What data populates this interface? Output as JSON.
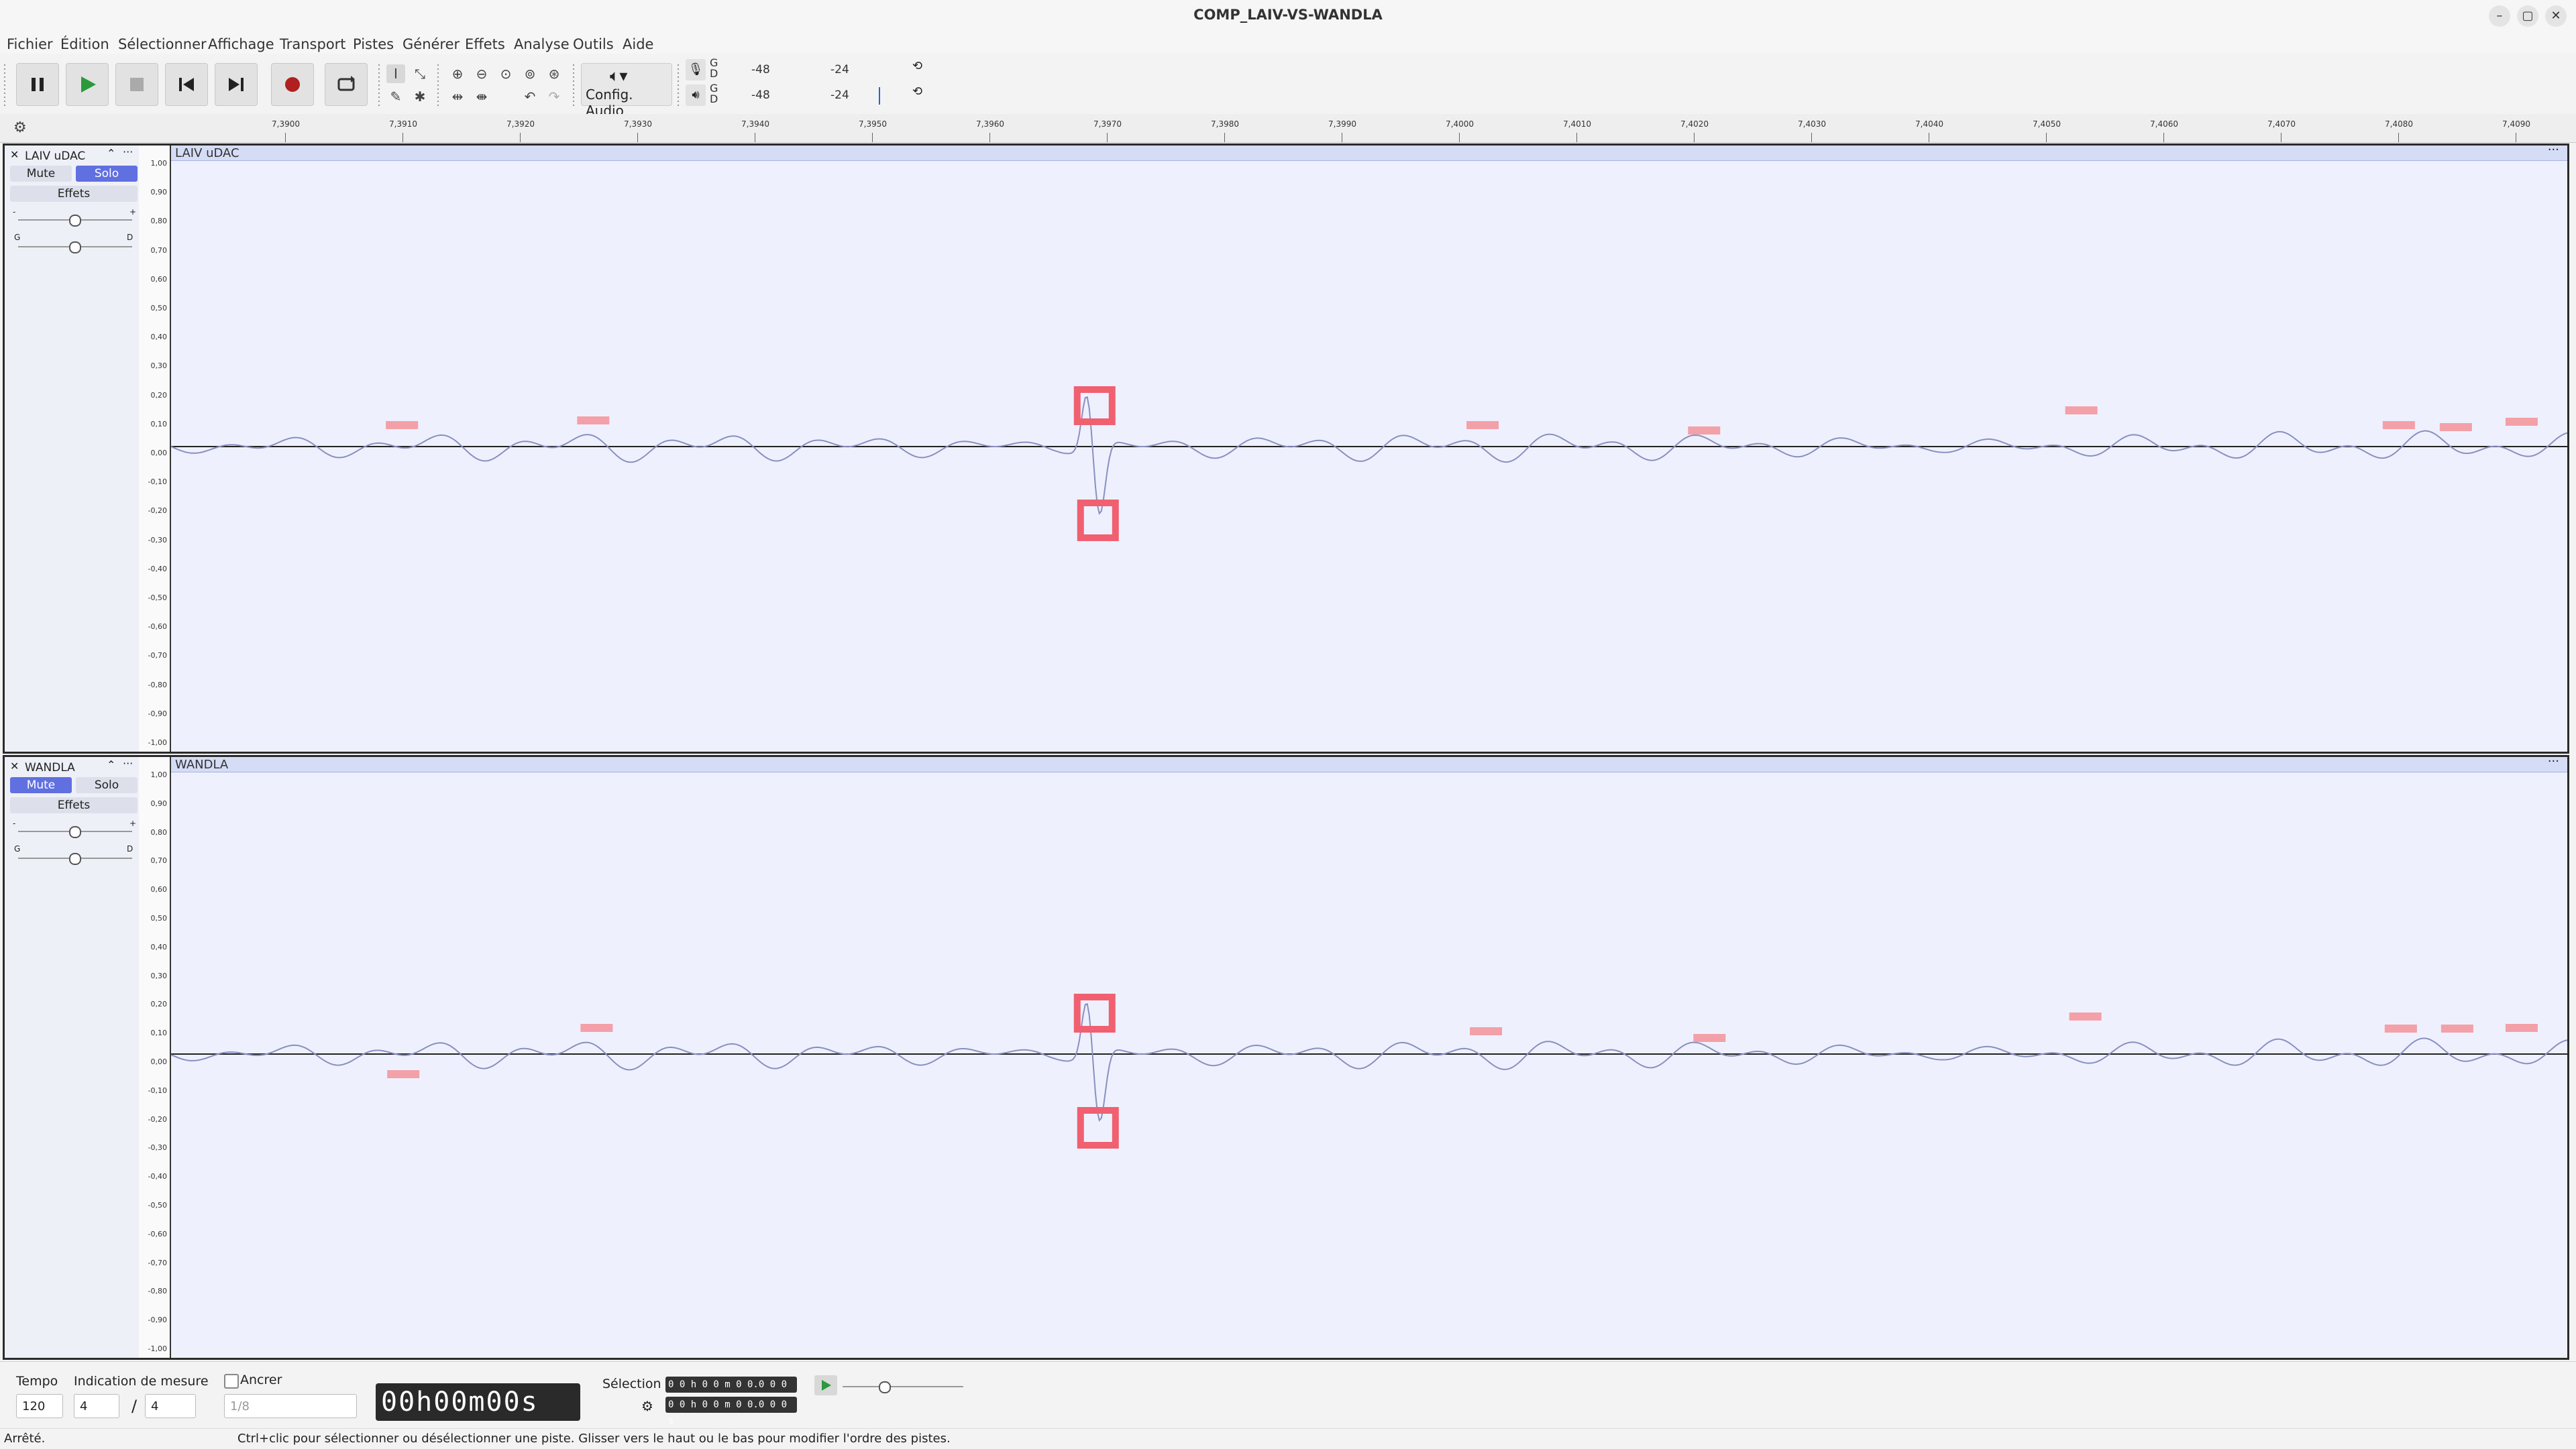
{
  "window": {
    "title": "COMP_LAIV-VS-WANDLA",
    "minimize": "–",
    "maximize": "▢",
    "close": "✕"
  },
  "menu": [
    "Fichier",
    "Édition",
    "Sélectionner",
    "Affichage",
    "Transport",
    "Pistes",
    "Générer",
    "Effets",
    "Analyse",
    "Outils",
    "Aide"
  ],
  "toolbar": {
    "config_audio": "Config. Audio",
    "meter_record": {
      "channel_labels": "G\nD",
      "ticks": [
        "-48",
        "-24"
      ]
    },
    "meter_play": {
      "channel_labels": "G\nD",
      "ticks": [
        "-48",
        "-24"
      ]
    }
  },
  "ruler": {
    "ticks": [
      "7,3900",
      "7,3910",
      "7,3920",
      "7,3930",
      "7,3940",
      "7,3950",
      "7,3960",
      "7,3970",
      "7,3980",
      "7,3990",
      "7,4000",
      "7,4010",
      "7,4020",
      "7,4030",
      "7,4040",
      "7,4050",
      "7,4060",
      "7,4070",
      "7,4080",
      "7,4090"
    ]
  },
  "amplitude_ticks": [
    "1,00",
    "0,90",
    "0,80",
    "0,70",
    "0,60",
    "0,50",
    "0,40",
    "0,30",
    "0,20",
    "0,10",
    "0,00",
    "-0,10",
    "-0,20",
    "-0,30",
    "-0,40",
    "-0,50",
    "-0,60",
    "-0,70",
    "-0,80",
    "-0,90",
    "-1,00"
  ],
  "tracks": [
    {
      "name": "LAIV uDAC",
      "clip_title": "LAIV uDAC",
      "mute": "Mute",
      "solo": "Solo",
      "effects": "Effets",
      "mute_active": false,
      "solo_active": true,
      "gain_left": "-",
      "gain_right": "+",
      "pan_left": "G",
      "pan_right": "D"
    },
    {
      "name": "WANDLA",
      "clip_title": "WANDLA",
      "mute": "Mute",
      "solo": "Solo",
      "effects": "Effets",
      "mute_active": true,
      "solo_active": false,
      "gain_left": "-",
      "gain_right": "+",
      "pan_left": "G",
      "pan_right": "D"
    }
  ],
  "bottom": {
    "tempo_label": "Tempo",
    "tempo_value": "120",
    "signature_label": "Indication de mesure",
    "sig_num": "4",
    "sig_slash": "/",
    "sig_den": "4",
    "anchor_label": "Ancrer",
    "snap_value": "1/8",
    "time_display": "00h00m00s",
    "selection_label": "Sélection",
    "sel_start": "0 0 h 0 0 m 0 0.0 0 0 s",
    "sel_end": "0 0 h 0 0 m 0 0.0 0 0 s"
  },
  "status": {
    "left": "Arrêté.",
    "hint": "Ctrl+clic pour sélectionner ou désélectionner une piste. Glisser vers le haut ou le bas pour modifier l'ordre des pistes."
  },
  "colors": {
    "wave_bg": "#eef1fd",
    "wave_line": "#8a8fc0",
    "clip_marker": "#f06070",
    "solo_active": "#6070e0"
  }
}
